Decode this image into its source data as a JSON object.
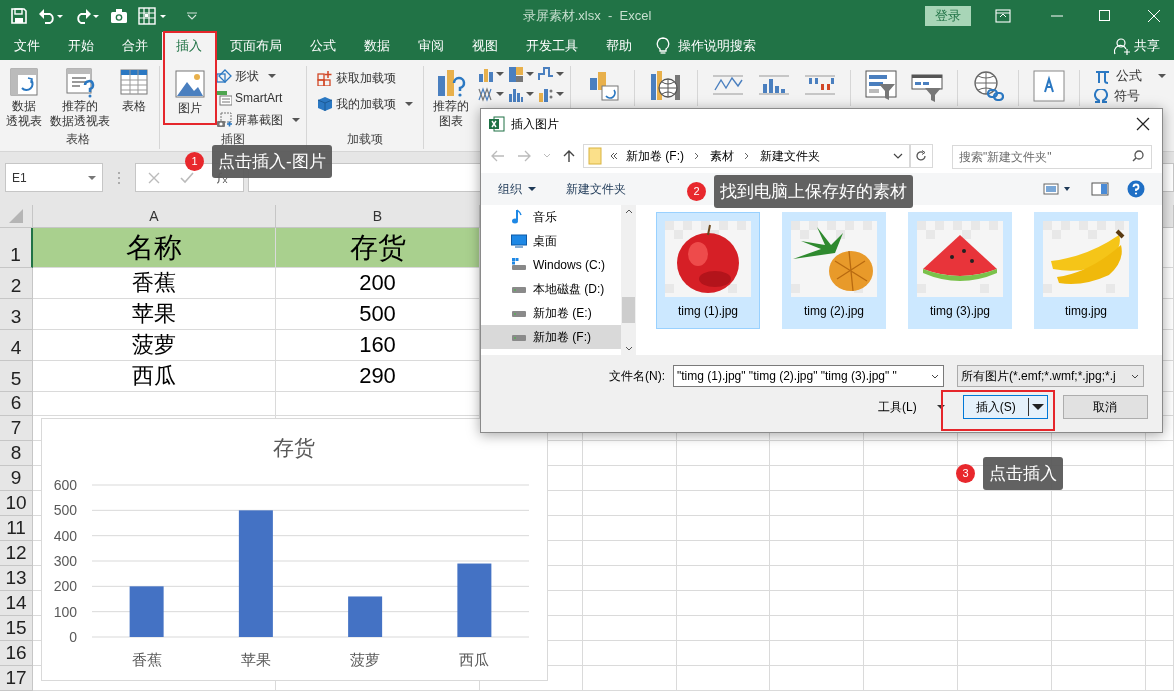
{
  "window": {
    "title": "录屏素材.xlsx  -  Excel",
    "sign_in": "登录"
  },
  "tabs": [
    {
      "label": "文件",
      "selected": false
    },
    {
      "label": "开始",
      "selected": false
    },
    {
      "label": "合并",
      "selected": false
    },
    {
      "label": "插入",
      "selected": true
    },
    {
      "label": "页面布局",
      "selected": false
    },
    {
      "label": "公式",
      "selected": false
    },
    {
      "label": "数据",
      "selected": false
    },
    {
      "label": "审阅",
      "selected": false
    },
    {
      "label": "视图",
      "selected": false
    },
    {
      "label": "开发工具",
      "selected": false
    },
    {
      "label": "帮助",
      "selected": false
    }
  ],
  "tell_me": "操作说明搜索",
  "share": "共享",
  "ribbon": {
    "groups": [
      {
        "label": "表格",
        "items": [
          {
            "kind": "large",
            "lines": [
              "数据",
              "透视表"
            ]
          },
          {
            "kind": "large",
            "lines": [
              "推荐的",
              "数据透视表"
            ]
          },
          {
            "kind": "large",
            "lines": [
              "表格"
            ]
          }
        ]
      },
      {
        "label": "插图",
        "items": [
          {
            "kind": "large",
            "lines": [
              "图片"
            ]
          },
          {
            "kind": "small",
            "label": "形状",
            "dropdown": true
          },
          {
            "kind": "small",
            "label": "SmartArt",
            "dropdown": false
          },
          {
            "kind": "small",
            "label": "屏幕截图",
            "dropdown": true
          }
        ]
      },
      {
        "label": "加载项",
        "items": [
          {
            "kind": "small",
            "label": "获取加载项",
            "dropdown": false
          },
          {
            "kind": "small",
            "label": "我的加载项",
            "dropdown": true
          }
        ]
      },
      {
        "items": [
          {
            "kind": "large",
            "lines": [
              "推荐的",
              "图表"
            ]
          },
          {
            "kind": "chart-grid"
          }
        ]
      }
    ],
    "formula": "公式",
    "symbol": "符号"
  },
  "formula_bar": {
    "name_box": "E1"
  },
  "sheet": {
    "columns": [
      "A",
      "B"
    ],
    "rows": [
      {
        "number": "1",
        "kind": "header",
        "cells": [
          "名称",
          "存货"
        ]
      },
      {
        "number": "2",
        "kind": "data",
        "cells": [
          "香蕉",
          "200"
        ]
      },
      {
        "number": "3",
        "kind": "data",
        "cells": [
          "苹果",
          "500"
        ]
      },
      {
        "number": "4",
        "kind": "data",
        "cells": [
          "菠萝",
          "160"
        ]
      },
      {
        "number": "5",
        "kind": "data",
        "cells": [
          "西瓜",
          "290"
        ]
      },
      {
        "number": "6",
        "kind": "empty"
      },
      {
        "number": "7",
        "kind": "empty"
      },
      {
        "number": "8",
        "kind": "empty"
      },
      {
        "number": "9",
        "kind": "empty"
      },
      {
        "number": "10",
        "kind": "empty"
      },
      {
        "number": "11",
        "kind": "empty"
      },
      {
        "number": "12",
        "kind": "empty"
      },
      {
        "number": "13",
        "kind": "empty"
      },
      {
        "number": "14",
        "kind": "empty"
      },
      {
        "number": "15",
        "kind": "empty"
      },
      {
        "number": "16",
        "kind": "empty"
      },
      {
        "number": "17",
        "kind": "empty"
      }
    ]
  },
  "chart": {
    "chart_data": {
      "type": "bar",
      "title": "存货",
      "categories": [
        "香蕉",
        "苹果",
        "菠萝",
        "西瓜"
      ],
      "values": [
        200,
        500,
        160,
        290
      ],
      "grid": true,
      "ylim": [
        0,
        600
      ],
      "yticks": [
        0,
        100,
        200,
        300,
        400,
        500,
        600
      ]
    }
  },
  "dialog": {
    "title": "插入图片",
    "path": [
      "新加卷 (F:)",
      "素材",
      "新建文件夹"
    ],
    "search_placeholder": "搜索\"新建文件夹\"",
    "organize": "组织",
    "new_folder": "新建文件夹",
    "nav": [
      {
        "kind": "music",
        "label": "音乐",
        "selected": false
      },
      {
        "kind": "desktop",
        "label": "桌面",
        "selected": false
      },
      {
        "kind": "system-drive",
        "label": "Windows (C:)",
        "selected": false
      },
      {
        "kind": "drive",
        "label": "本地磁盘 (D:)",
        "selected": false
      },
      {
        "kind": "drive",
        "label": "新加卷 (E:)",
        "selected": false
      },
      {
        "kind": "drive",
        "label": "新加卷 (F:)",
        "selected": true
      }
    ],
    "files": [
      {
        "name": "timg (1).jpg",
        "selected": true,
        "focused": true
      },
      {
        "name": "timg (2).jpg",
        "selected": true,
        "focused": false
      },
      {
        "name": "timg (3).jpg",
        "selected": true,
        "focused": false
      },
      {
        "name": "timg.jpg",
        "selected": true,
        "focused": false
      }
    ],
    "filename_label": "文件名(N):",
    "filename": "\"timg (1).jpg\" \"timg (2).jpg\" \"timg (3).jpg\" \"",
    "filter": "所有图片(*.emf;*.wmf;*.jpg;*.j",
    "tools": "工具(L)",
    "insert": "插入(S)",
    "cancel": "取消"
  },
  "callouts": [
    {
      "number": "1",
      "text": "点击插入-图片"
    },
    {
      "number": "2",
      "text": "找到电脑上保存好的素材"
    },
    {
      "number": "3",
      "text": "点击插入"
    }
  ]
}
